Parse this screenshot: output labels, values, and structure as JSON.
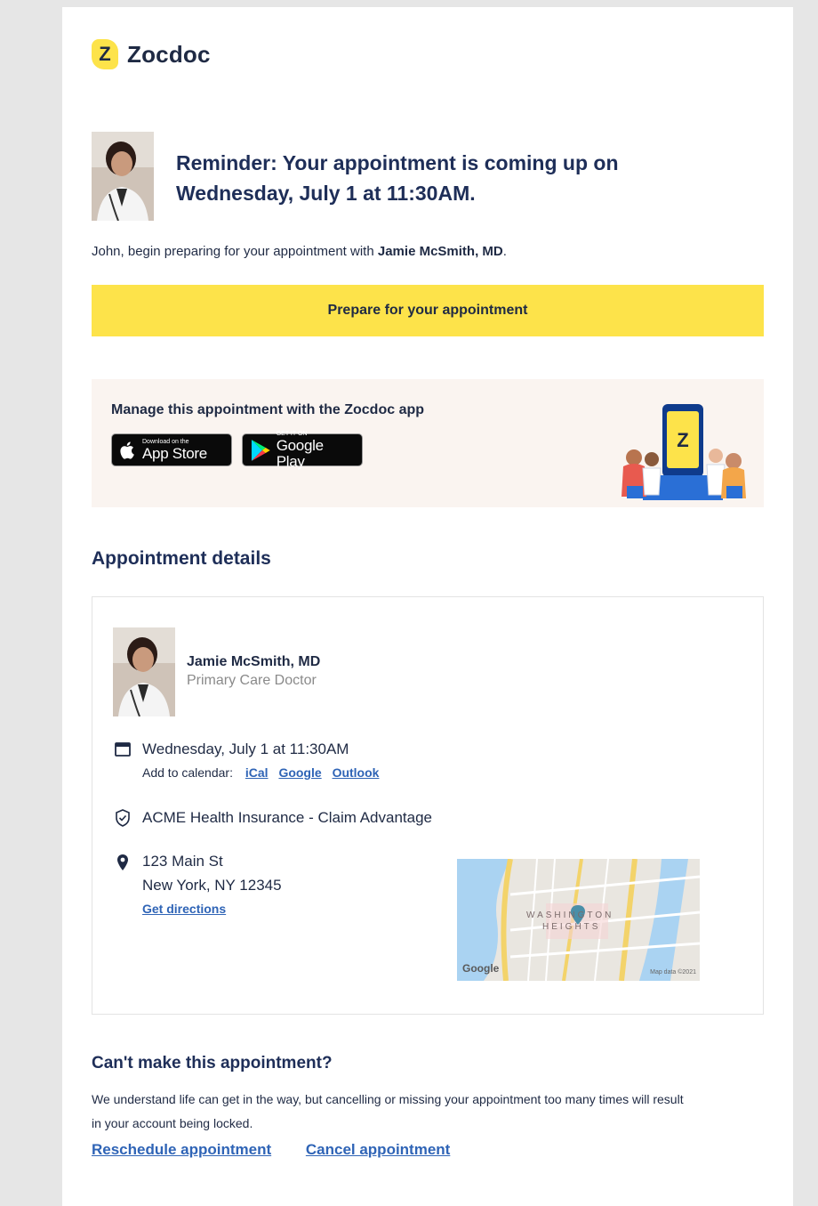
{
  "brand": {
    "name": "Zocdoc",
    "mark": "Z"
  },
  "header": {
    "headline_line1": "Reminder: Your appointment is coming up on",
    "headline_line2": "Wednesday, July 1 at 11:30AM."
  },
  "greeting": {
    "prefix": "John, begin preparing for your appointment with ",
    "doctor": "Jamie McSmith, MD",
    "suffix": "."
  },
  "prepare_button": "Prepare for your appointment",
  "app_promo": {
    "title": "Manage this appointment with the Zocdoc app",
    "app_store": {
      "small": "Download on the",
      "big": "App Store"
    },
    "google_play": {
      "small": "GET IT ON",
      "big": "Google Play"
    }
  },
  "details": {
    "title": "Appointment details",
    "doctor_name": "Jamie McSmith, MD",
    "specialty": "Primary Care Doctor",
    "datetime": "Wednesday, July 1 at 11:30AM",
    "add_to_calendar_label": "Add to calendar:",
    "calendar_links": [
      "iCal",
      "Google",
      "Outlook"
    ],
    "insurance": "ACME Health Insurance - Claim Advantage",
    "address_line1": "123 Main St",
    "address_line2": "New York, NY 12345",
    "directions_link": "Get directions",
    "map": {
      "neighborhood_line1": "WASHINGTON",
      "neighborhood_line2": "HEIGHTS",
      "credit": "Map data ©2021",
      "logo": "Google"
    }
  },
  "cancel_section": {
    "title": "Can't make this appointment?",
    "text_line1": "We understand life can get in the way, but cancelling or missing your appointment too many times will result",
    "text_line2": "in your account being locked.",
    "reschedule_link": "Reschedule appointment",
    "cancel_link": "Cancel appointment"
  },
  "colors": {
    "accent_yellow": "#fde34a",
    "navy": "#1e2e58",
    "link_blue": "#2f64b6",
    "promo_bg": "#faf4f0"
  }
}
